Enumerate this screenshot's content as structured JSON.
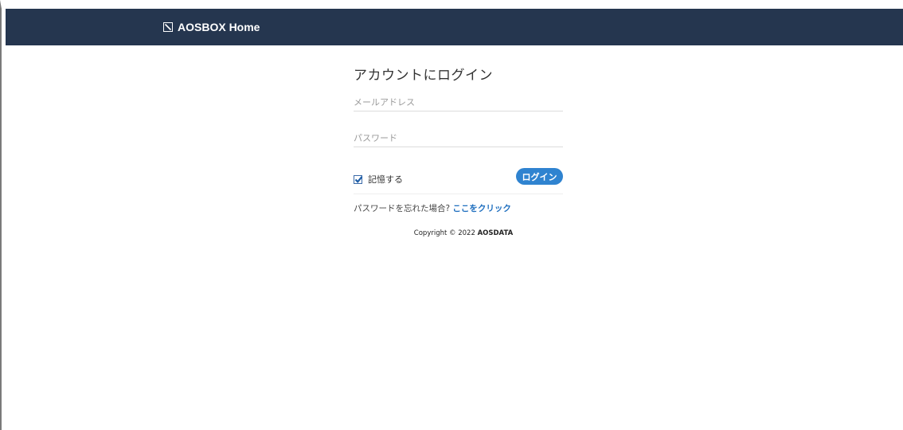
{
  "header": {
    "brand_label": "AOSBOX Home",
    "brand_icon": "aosbox-logo-icon",
    "background": "#25364f"
  },
  "login": {
    "title": "アカウントにログイン",
    "email_placeholder": "メールアドレス",
    "password_placeholder": "パスワード",
    "remember_label": "記憶する",
    "remember_checked": true,
    "submit_label": "ログイン",
    "submit_color": "#2f83d0",
    "forgot_text": "パスワードを忘れた場合?",
    "forgot_link": "ここをクリック",
    "link_color": "#1f6fbf"
  },
  "footer": {
    "copyright_prefix": "Copyright © 2022",
    "company": "AOSDATA"
  }
}
